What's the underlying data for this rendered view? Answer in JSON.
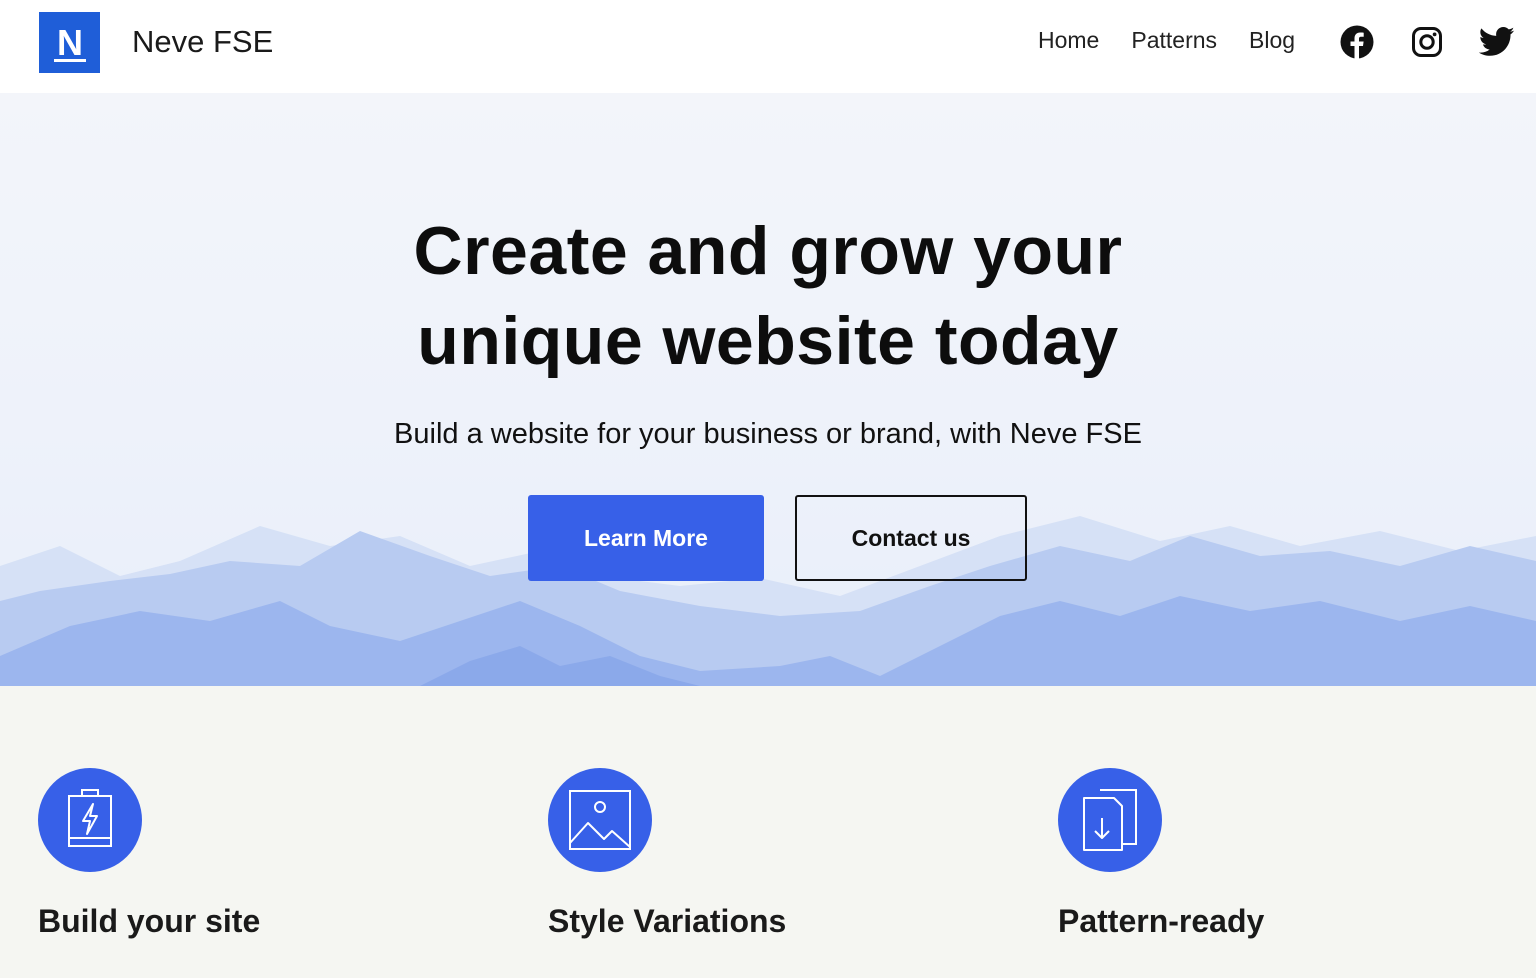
{
  "header": {
    "site_title": "Neve FSE",
    "logo_letter": "N",
    "nav": [
      {
        "label": "Home"
      },
      {
        "label": "Patterns"
      },
      {
        "label": "Blog"
      }
    ],
    "social": [
      "facebook-icon",
      "instagram-icon",
      "twitter-icon"
    ]
  },
  "hero": {
    "heading_line1": "Create and grow your",
    "heading_line2": "unique website today",
    "subheading": "Build a website for your business or brand, with Neve FSE",
    "primary_button": "Learn More",
    "secondary_button": "Contact us"
  },
  "features": [
    {
      "title": "Build your site",
      "icon": "battery-bolt-icon"
    },
    {
      "title": "Style Variations",
      "icon": "image-icon"
    },
    {
      "title": "Pattern-ready",
      "icon": "documents-download-icon"
    }
  ],
  "colors": {
    "accent": "#3760e8",
    "logo": "#1f5ed8",
    "hero_bg": "#eef2fa",
    "features_bg": "#f5f6f2"
  }
}
